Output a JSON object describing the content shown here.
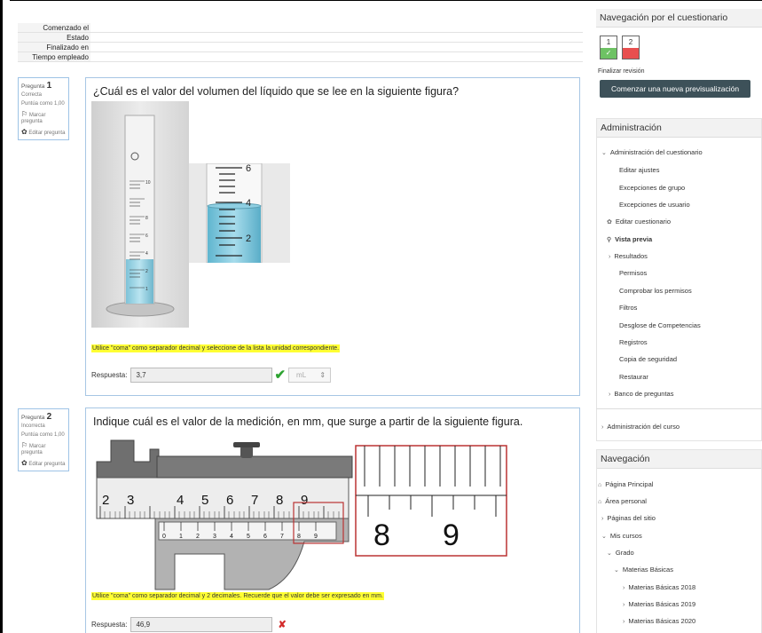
{
  "summary": {
    "rows": [
      {
        "label": "Comenzado el",
        "value": ""
      },
      {
        "label": "Estado",
        "value": ""
      },
      {
        "label": "Finalizado en",
        "value": ""
      },
      {
        "label": "Tiempo empleado",
        "value": ""
      }
    ]
  },
  "questions": [
    {
      "label": "Pregunta",
      "number": "1",
      "state": "Correcta",
      "grade": "Puntúa como 1,00",
      "flag": "Marcar pregunta",
      "edit": "Editar pregunta",
      "text": "¿Cuál es el valor del volumen del líquido que se lee en la siguiente figura?",
      "hint": "Utilice \"coma\" como separador decimal y seleccione de la lista la unidad correspondiente.",
      "answer_label": "Respuesta:",
      "answer_value": "3,7",
      "unit": "mL",
      "result_icon": "check-icon",
      "status_color": "#2ea332"
    },
    {
      "label": "Pregunta",
      "number": "2",
      "state": "Incorrecta",
      "grade": "Puntúa como 1,00",
      "flag": "Marcar pregunta",
      "edit": "Editar pregunta",
      "text": "Indique cuál es el valor de la medición, en mm, que surge a partir de la siguiente figura.",
      "hint": "Utilice \"coma\" como separador decimal y 2 decimales. Recuerde que el valor debe ser expresado en mm.",
      "answer_label": "Respuesta:",
      "answer_value": "46,9",
      "result_icon": "cross-icon",
      "status_color": "#d32b2b"
    }
  ],
  "figures": {
    "cylinder_marks": [
      "10",
      "8",
      "6",
      "4",
      "2",
      "1"
    ],
    "zoom_marks": [
      "6",
      "4",
      "2"
    ],
    "caliper_main": [
      "2",
      "3",
      "4",
      "5",
      "6",
      "7",
      "8",
      "9"
    ],
    "caliper_vernier": [
      "0",
      "1",
      "2",
      "3",
      "4",
      "5",
      "6",
      "7",
      "8",
      "9"
    ],
    "zoom_caliper": [
      "8",
      "9"
    ]
  },
  "sidebar": {
    "quiz_nav": {
      "title": "Navegación por el cuestionario",
      "buttons": [
        {
          "num": "1",
          "mark": "✓"
        },
        {
          "num": "2",
          "mark": ""
        }
      ],
      "finish": "Finalizar revisión",
      "new_preview": "Comenzar una nueva previsualización"
    },
    "admin": {
      "title": "Administración",
      "items": [
        "Administración del cuestionario",
        "Editar ajustes",
        "Excepciones de grupo",
        "Excepciones de usuario",
        "Editar cuestionario",
        "Vista previa",
        "Resultados",
        "Permisos",
        "Comprobar los permisos",
        "Filtros",
        "Desglose de Competencias",
        "Registros",
        "Copia de seguridad",
        "Restaurar",
        "Banco de preguntas",
        "Administración del curso"
      ]
    },
    "nav": {
      "title": "Navegación",
      "items": [
        "Página Principal",
        "Área personal",
        "Páginas del sitio",
        "Mis cursos",
        "Grado",
        "Materias Básicas",
        "Materias Básicas 2018",
        "Materias Básicas 2019",
        "Materias Básicas 2020"
      ]
    }
  }
}
